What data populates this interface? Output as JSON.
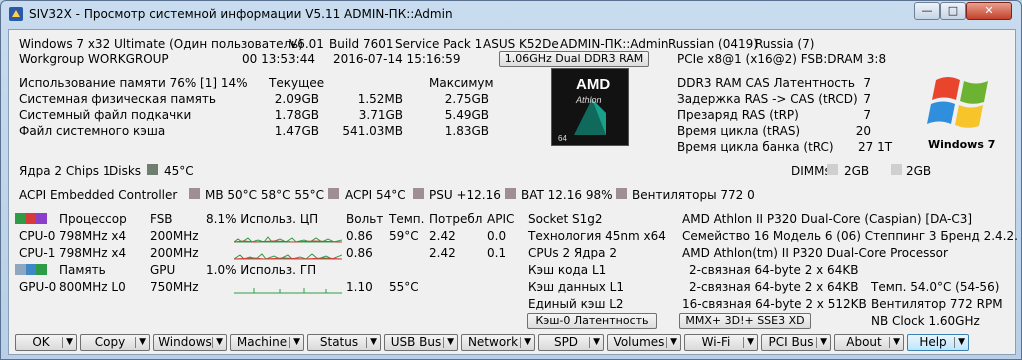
{
  "window": {
    "title": "SIV32X - Просмотр системной информации V5.11 ADMIN-ПК::Admin"
  },
  "sysinfo": {
    "os": "Windows 7 x32 Ultimate (Один пользователь)",
    "ver": "V6.01",
    "build": "Build 7601",
    "sp": "Service Pack 1",
    "model": "ASUS K52De",
    "machine": "ADMIN-ПК::Admin",
    "lang": "Russian (0419)",
    "region": "Russia (7)",
    "workgroup": "Workgroup WORKGROUP",
    "uptime": "00 13:53:44",
    "datetime": "2016-07-14 15:16:59",
    "mem_button": "1.06GHz Dual DDR3 RAM",
    "pcie": "PCIe x8@1 (x16@2) FSB:DRAM 3:8"
  },
  "memory": {
    "usage": "Использование памяти 76% [1] 14%",
    "h_current": "Текущее",
    "h_max": "Максимум",
    "rows": [
      {
        "label": "Системная физическая память",
        "v1": "2.09GB",
        "v2": "1.52MB",
        "v3": "2.75GB"
      },
      {
        "label": "Системный файл подкачки",
        "v1": "1.78GB",
        "v2": "3.71GB",
        "v3": "5.49GB"
      },
      {
        "label": "Файл системного кэша",
        "v1": "1.47GB",
        "v2": "541.03MB",
        "v3": "1.83GB"
      }
    ]
  },
  "cpu_logo": {
    "brand": "AMD",
    "model": "Athlon",
    "bits": "64"
  },
  "ddr": [
    {
      "label": "DDR3 RAM CAS Латентность",
      "value": "7"
    },
    {
      "label": "Задержка RAS -> CAS (tRCD)",
      "value": "7"
    },
    {
      "label": "Презаряд RAS (tRP)",
      "value": "7"
    },
    {
      "label": "Время цикла (tRAS)",
      "value": "20"
    },
    {
      "label": "Время цикла банка (tRC)",
      "value": "27 1T"
    }
  ],
  "win_logo": {
    "text": "Windows 7"
  },
  "cores": {
    "label": "Ядра 2 Chips 1",
    "disks": "Disks",
    "temp": "45°C"
  },
  "dimms": {
    "label": "DIMMs",
    "d1": "2GB",
    "d2": "2GB"
  },
  "acpi": {
    "label": "ACPI Embedded Controller",
    "items": [
      "MB 50°C 58°C 55°C",
      "ACPI 54°C",
      "PSU +12.16",
      "BAT 12.16 98%",
      "Вентиляторы 772 0"
    ]
  },
  "cpu_table": {
    "h_proc": "Процессор",
    "h_fsb": "FSB",
    "h_use": "8.1% Использ. ЦП",
    "h_volt": "Вольт",
    "h_temp": "Темп.",
    "h_pow": "Потребл",
    "h_apic": "APIC",
    "rows": [
      {
        "name": "CPU-0",
        "clock": "798MHz x4",
        "fsb": "200MHz",
        "volt": "0.86",
        "temp": "59°C",
        "pow": "2.42",
        "apic": "0.0"
      },
      {
        "name": "CPU-1",
        "clock": "798MHz x4",
        "fsb": "200MHz",
        "volt": "0.86",
        "temp": "",
        "pow": "2.42",
        "apic": "0.1"
      }
    ],
    "h_mem": "Память",
    "h_gpu": "GPU",
    "h_gpu_use": "1.0% Использ. ГП",
    "gpu": {
      "name": "GPU-0",
      "clock": "800MHz L0",
      "fsb": "750MHz",
      "volt": "1.10",
      "temp": "55°C"
    }
  },
  "cpuinfo": {
    "socket": "Socket S1g2",
    "tech": "Технология 45nm  x64",
    "cpus": "CPUs 2 Ядра 2",
    "l1c": "Кэш кода L1",
    "l1d": "Кэш данных L1",
    "l2": "Единый кэш L2",
    "latency_btn": "Кэш-0 Латентность",
    "name": "AMD Athlon II P320 Dual-Core (Caspian) [DA-C3]",
    "family": "Семейство 16  Модель 6 (06)  Степпинг 3  Бренд 2.4.2.",
    "fullname": "AMD Athlon(tm) II P320 Dual-Core Processor",
    "l1c_v": "2-связная 64-byte  2 x 64KB",
    "l1d_v": "2-связная 64-byte  2 x 64KB",
    "l2_v": "16-связная 64-byte  2 x 512KB",
    "ext_btn": "MMX+ 3D!+ SSE3 XD",
    "temp": "Темп.  54.0°C (54-56)",
    "fan": "Вентилятор  772 RPM",
    "nbclock": "NB Clock    1.60GHz"
  },
  "toolbar": [
    "OK",
    "Copy",
    "Windows",
    "Machine",
    "Status",
    "USB Bus",
    "Network",
    "SPD",
    "Volumes",
    "Wi-Fi",
    "PCI Bus",
    "About",
    "Help"
  ]
}
